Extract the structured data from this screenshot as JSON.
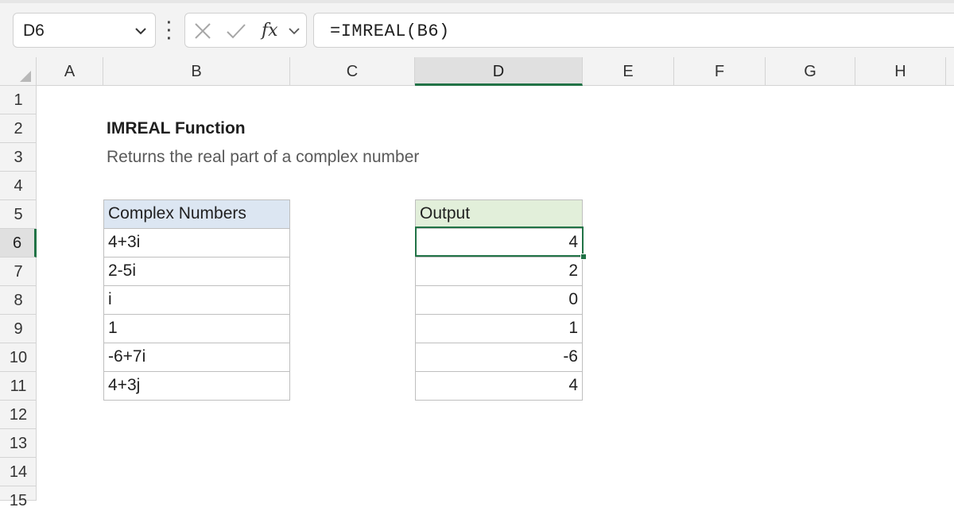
{
  "formula_bar": {
    "name_box": "D6",
    "formula": "=IMREAL(B6)",
    "fx_label": "fx"
  },
  "columns": [
    "A",
    "B",
    "C",
    "D",
    "E",
    "F",
    "G",
    "H"
  ],
  "rows": [
    "1",
    "2",
    "3",
    "4",
    "5",
    "6",
    "7",
    "8",
    "9",
    "10",
    "11",
    "12",
    "13",
    "14",
    "15"
  ],
  "selected": {
    "column": "D",
    "row": "6"
  },
  "sheet": {
    "title": "IMREAL Function",
    "subtitle": "Returns the real part of a complex number",
    "input_header": "Complex Numbers",
    "inputs": [
      "4+3i",
      "2-5i",
      "i",
      "1",
      "-6+7i",
      "4+3j"
    ],
    "output_header": "Output",
    "outputs": [
      "4",
      "2",
      "0",
      "1",
      "-6",
      "4"
    ]
  },
  "colors": {
    "input_header_fill": "#dce6f2",
    "output_header_fill": "#e2efda",
    "selection": "#217346"
  }
}
